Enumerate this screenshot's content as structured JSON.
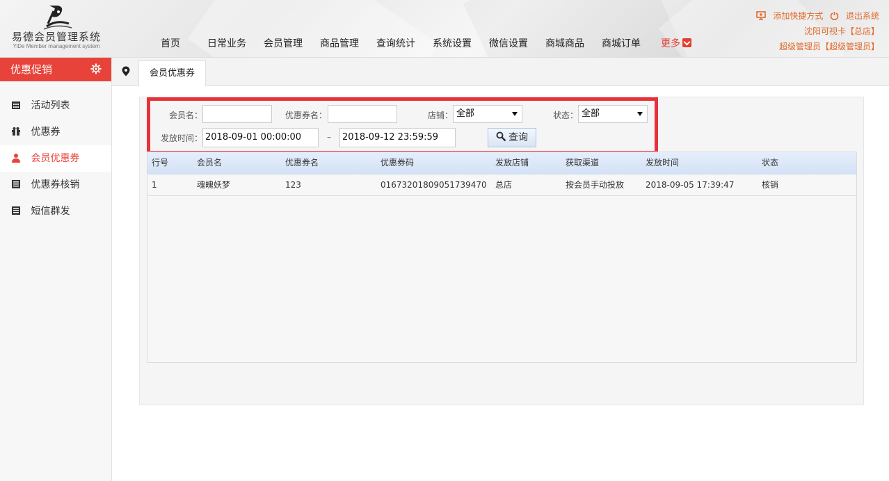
{
  "logo": {
    "title": "易德会员管理系统",
    "subtitle": "YiDe Member management system"
  },
  "nav": {
    "items": [
      "首页",
      "日常业务",
      "会员管理",
      "商品管理",
      "查询统计",
      "系统设置",
      "微信设置",
      "商城商品",
      "商城订单"
    ],
    "more": "更多"
  },
  "top_right": {
    "add_shortcut": "添加快捷方式",
    "logout": "退出系统",
    "store": "沈阳可视卡【总店】",
    "user": "超级管理员【超级管理员】"
  },
  "sidebar": {
    "title": "优惠促销",
    "items": [
      {
        "label": "活动列表",
        "icon": "calendar-icon"
      },
      {
        "label": "优惠券",
        "icon": "gift-icon"
      },
      {
        "label": "会员优惠券",
        "icon": "user-icon"
      },
      {
        "label": "优惠券核销",
        "icon": "list-icon"
      },
      {
        "label": "短信群发",
        "icon": "list-icon"
      }
    ],
    "active_index": 2
  },
  "tab": {
    "label": "会员优惠券"
  },
  "filter": {
    "member_label": "会员名：",
    "member_value": "",
    "coupon_label": "优惠券名：",
    "coupon_value": "",
    "store_label": "店铺：",
    "store_value": "全部",
    "status_label": "状态：",
    "status_value": "全部",
    "time_label": "发放时间：",
    "time_from": "2018-09-01 00:00:00",
    "time_sep": "–",
    "time_to": "2018-09-12 23:59:59",
    "query_label": "查询"
  },
  "table": {
    "columns": [
      "行号",
      "会员名",
      "优惠券名",
      "优惠券码",
      "发放店铺",
      "获取渠道",
      "发放时间",
      "状态"
    ],
    "rows": [
      [
        "1",
        "魂魄妖梦",
        "123",
        "01673201809051739470",
        "总店",
        "按会员手动投放",
        "2018-09-05 17:39:47",
        "核销"
      ]
    ]
  },
  "colors": {
    "accent": "#e8433a",
    "highlight_box": "#e8303a",
    "link": "#e06a2c"
  }
}
